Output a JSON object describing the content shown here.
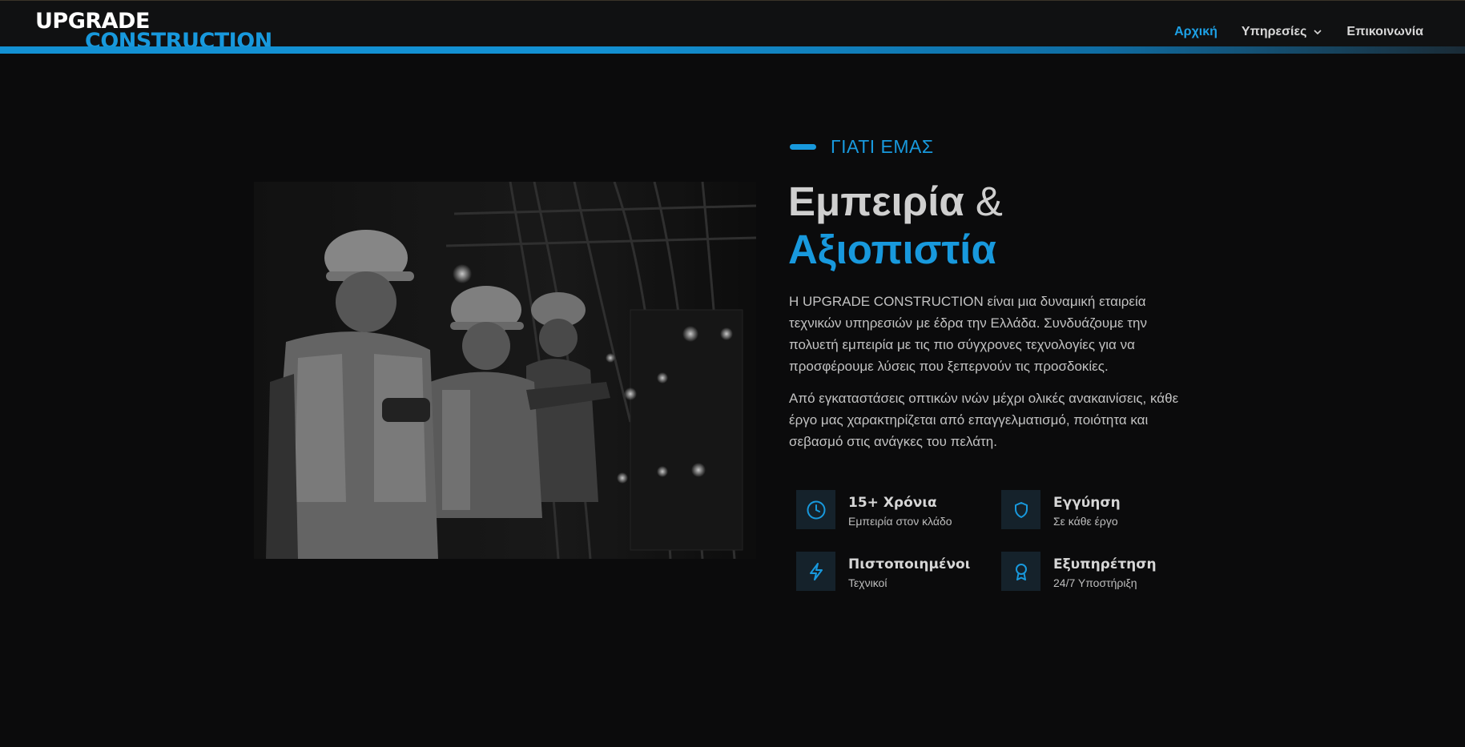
{
  "brand": {
    "line1": "UPGRADE",
    "line2": "CONSTRUCTION"
  },
  "nav": {
    "items": [
      {
        "label": "Αρχική",
        "active": true
      },
      {
        "label": "Υπηρεσίες",
        "dropdown": true
      },
      {
        "label": "Επικοινωνία"
      }
    ]
  },
  "section": {
    "eyebrow": "ΓΙΑΤΙ ΕΜΑΣ",
    "title_part1": "Εμπειρία",
    "title_amp": " &",
    "title_part2": "Αξιοπιστία",
    "paragraph1": "Η UPGRADE CONSTRUCTION είναι μια δυναμική εταιρεία τεχνικών υπηρεσιών με έδρα την Ελλάδα. Συνδυάζουμε την πολυετή εμπειρία με τις πιο σύγχρονες τεχνολογίες για να προσφέρουμε λύσεις που ξεπερνούν τις προσδοκίες.",
    "paragraph2": "Από εγκαταστάσεις οπτικών ινών μέχρι ολικές ανακαινίσεις, κάθε έργο μας χαρακτηρίζεται από επαγγελματισμό, ποιότητα και σεβασμό στις ανάγκες του πελάτη."
  },
  "features": [
    {
      "icon": "clock-icon",
      "title": "15+ Χρόνια",
      "subtitle": "Εμπειρία στον κλάδο"
    },
    {
      "icon": "shield-icon",
      "title": "Εγγύηση",
      "subtitle": "Σε κάθε έργο"
    },
    {
      "icon": "lightning-icon",
      "title": "Πιστοποιημένοι",
      "subtitle": "Τεχνικοί"
    },
    {
      "icon": "award-icon",
      "title": "Εξυπηρέτηση",
      "subtitle": "24/7 Υποστήριξη"
    }
  ],
  "colors": {
    "accent": "#1899dd",
    "background": "#0b0b0c",
    "icon_bg": "#15222b"
  }
}
